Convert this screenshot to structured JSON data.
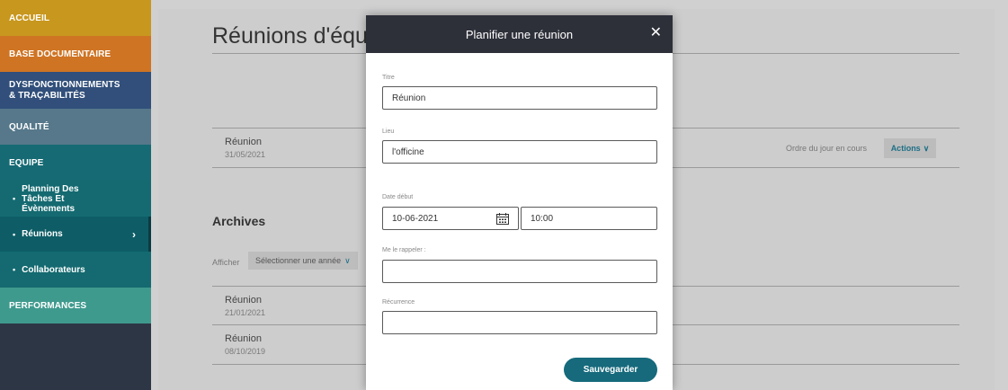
{
  "sidebar": {
    "items": [
      {
        "label": "ACCUEIL",
        "color": "#c8971e"
      },
      {
        "label": "BASE DOCUMENTAIRE",
        "color": "#cf7423"
      },
      {
        "label": "DYSFONCTIONNEMENTS & TRAÇABILITÉS",
        "color": "#314f7a"
      },
      {
        "label": "QUALITÉ",
        "color": "#56788a"
      },
      {
        "label": "EQUIPE",
        "color": "#156a73"
      },
      {
        "label": "PERFORMANCES",
        "color": "#3f9a8e"
      }
    ],
    "equipe_subitems": [
      {
        "label": "Planning Des Tâches Et Évènements"
      },
      {
        "label": "Réunions",
        "active": true
      },
      {
        "label": "Collaborateurs"
      }
    ]
  },
  "page": {
    "title": "Réunions d'équi",
    "current_meetings": [
      {
        "title": "Réunion",
        "date": "31/05/2021",
        "status": "Ordre du jour en cours",
        "actions_label": "Actions"
      }
    ],
    "archives_heading": "Archives",
    "afficher_label": "Afficher",
    "year_select_value": "Sélectionner une année",
    "archived_meetings": [
      {
        "title": "Réunion",
        "date": "21/01/2021"
      },
      {
        "title": "Réunion",
        "date": "08/10/2019"
      }
    ]
  },
  "modal": {
    "title": "Planifier une réunion",
    "close_icon": "close-icon",
    "fields": {
      "titre": {
        "label": "Titre",
        "value": "Réunion"
      },
      "lieu": {
        "label": "Lieu",
        "value": "l'officine"
      },
      "date_debut": {
        "label": "Date début",
        "date_value": "10-06-2021",
        "time_value": "10:00"
      },
      "rappel": {
        "label": "Me le rappeler :",
        "value": ""
      },
      "recurrence": {
        "label": "Récurrence",
        "value": ""
      }
    },
    "save_label": "Sauvegarder"
  },
  "colors": {
    "accent": "#166a7c",
    "modal_header": "#2d2f39",
    "sidebar_bg": "#2d3645"
  }
}
